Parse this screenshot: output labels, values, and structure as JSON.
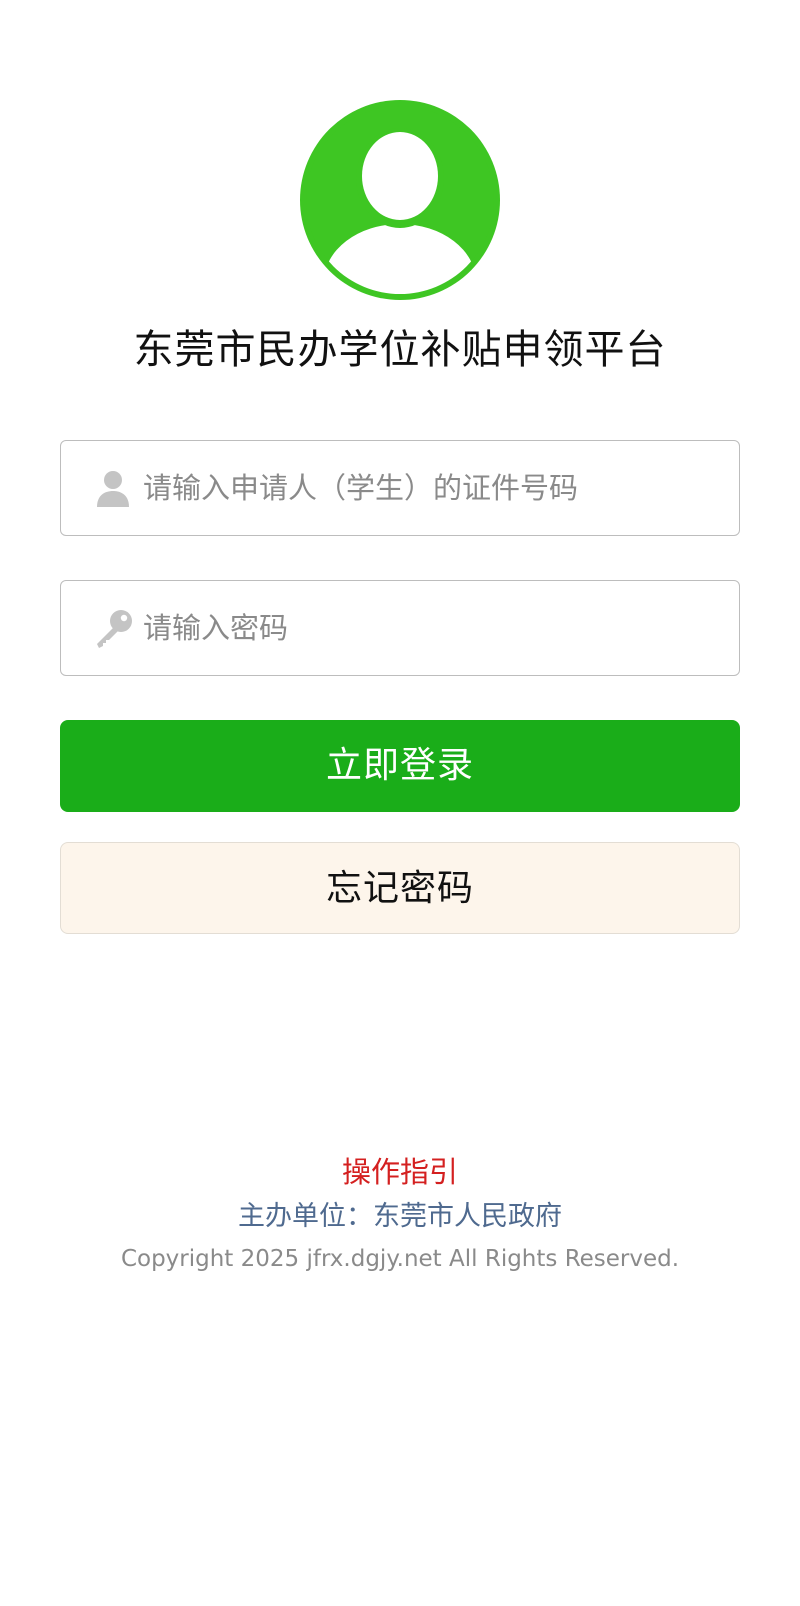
{
  "app": {
    "title": "东莞市民办学位补贴申领平台"
  },
  "avatar": {
    "icon": "user-avatar-icon",
    "color": "#3ec623"
  },
  "form": {
    "id_field": {
      "placeholder": "请输入申请人（学生）的证件号码",
      "value": "",
      "icon": "user-icon"
    },
    "password_field": {
      "placeholder": "请输入密码",
      "value": "",
      "icon": "key-icon"
    }
  },
  "buttons": {
    "login_label": "立即登录",
    "forgot_label": "忘记密码"
  },
  "footer": {
    "guide_link": "操作指引",
    "host": "主办单位：东莞市人民政府",
    "copyright": "Copyright 2025 jfrx.dgjy.net All Rights Reserved."
  },
  "colors": {
    "primary_green": "#1aad19",
    "avatar_green": "#3ec623",
    "forgot_bg": "#fdf5eb",
    "guide_red": "#d42020",
    "host_blue": "#4f6a8f"
  }
}
